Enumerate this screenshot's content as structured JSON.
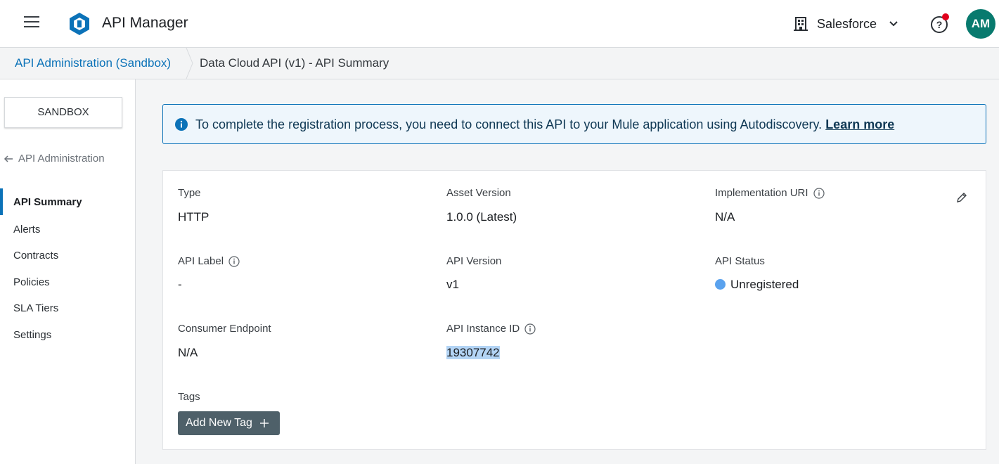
{
  "header": {
    "app_title": "API Manager",
    "org_name": "Salesforce",
    "avatar_initials": "AM",
    "avatar_color": "#087a6e",
    "help_has_notification": true
  },
  "breadcrumb": {
    "parent": "API Administration (Sandbox)",
    "current": "Data Cloud API (v1) - API Summary"
  },
  "sidebar": {
    "environment": "SANDBOX",
    "back_label": "API Administration",
    "items": [
      {
        "label": "API Summary",
        "active": true
      },
      {
        "label": "Alerts"
      },
      {
        "label": "Contracts"
      },
      {
        "label": "Policies"
      },
      {
        "label": "SLA Tiers"
      },
      {
        "label": "Settings"
      }
    ]
  },
  "banner": {
    "message": "To complete the registration process, you need to connect this API to your Mule application using Autodiscovery.",
    "link": "Learn more"
  },
  "summary": {
    "type_label": "Type",
    "type_value": "HTTP",
    "asset_version_label": "Asset Version",
    "asset_version_value": "1.0.0 (Latest)",
    "impl_uri_label": "Implementation URI",
    "impl_uri_value": "N/A",
    "api_label_label": "API Label",
    "api_label_value": "-",
    "api_version_label": "API Version",
    "api_version_value": "v1",
    "api_status_label": "API Status",
    "api_status_value": "Unregistered",
    "consumer_endpoint_label": "Consumer Endpoint",
    "consumer_endpoint_value": "N/A",
    "instance_id_label": "API Instance ID",
    "instance_id_value": "19307742",
    "tags_label": "Tags",
    "add_tag_label": "Add New Tag"
  },
  "colors": {
    "accent": "#0b72b8",
    "status_unregistered": "#5aa2ee",
    "tag_button": "#4e6069"
  }
}
